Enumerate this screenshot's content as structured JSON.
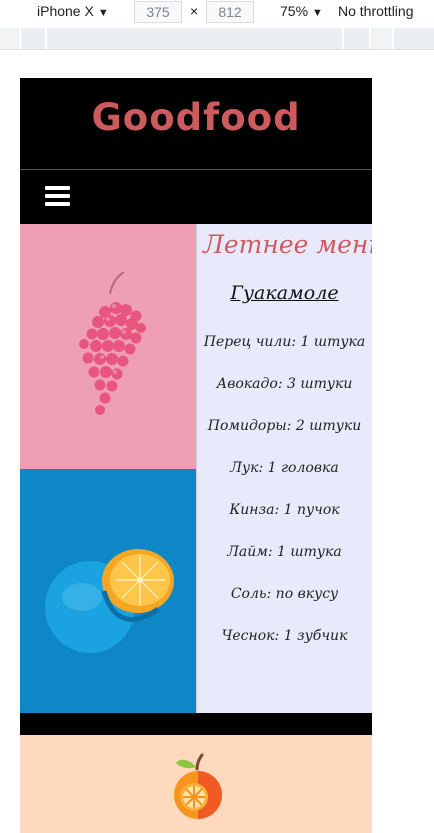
{
  "devtools": {
    "device": "iPhone X",
    "width": "375",
    "times": "×",
    "height": "812",
    "zoom": "75%",
    "throttling": "No throttling"
  },
  "site": {
    "logo": "Goodfood",
    "menu_title": "Летнее меню",
    "recipe_title": "Гуакамоле",
    "ingredients": [
      "Перец чили: 1 штука",
      "Авокадо: 3 штуки",
      "Помидоры: 2 штуки",
      "Лук: 1 головка",
      "Кинза: 1 пучок",
      "Лайм: 1 штука",
      "Соль: по вкусу",
      "Чеснок: 1 зубчик"
    ]
  },
  "colors": {
    "brand": "#cd5b5e",
    "header_bg": "#000000",
    "menu_bg": "#e8eafb",
    "pink_photo": "#ef9fb5",
    "blue_photo": "#0f87c7",
    "footer_bg": "#fed9bd"
  },
  "icons": {
    "menu": "hamburger-icon",
    "dropdown": "caret-down-icon",
    "footer": "orange-fruit-icon"
  }
}
